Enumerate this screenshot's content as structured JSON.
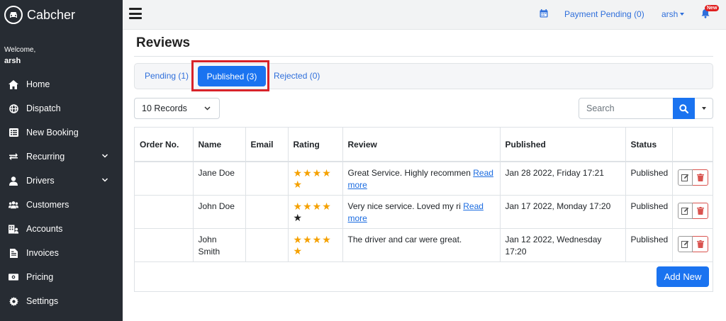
{
  "brand": {
    "name": "Cabcher",
    "icon": "car-icon"
  },
  "sidebar": {
    "welcome": "Welcome,",
    "user": "arsh",
    "items": [
      {
        "label": "Home",
        "icon": "home-icon"
      },
      {
        "label": "Dispatch",
        "icon": "globe-icon"
      },
      {
        "label": "New Booking",
        "icon": "list-icon"
      },
      {
        "label": "Recurring",
        "icon": "repeat-icon",
        "expandable": true
      },
      {
        "label": "Drivers",
        "icon": "user-icon",
        "expandable": true
      },
      {
        "label": "Customers",
        "icon": "users-icon"
      },
      {
        "label": "Accounts",
        "icon": "accounts-icon"
      },
      {
        "label": "Invoices",
        "icon": "invoice-icon"
      },
      {
        "label": "Pricing",
        "icon": "money-icon"
      },
      {
        "label": "Settings",
        "icon": "gear-icon"
      }
    ]
  },
  "topbar": {
    "payment_label": "Payment Pending (0)",
    "user_label": "arsh",
    "notification_badge": "New"
  },
  "page": {
    "title": "Reviews"
  },
  "tabs": [
    {
      "label": "Pending (1)",
      "active": false
    },
    {
      "label": "Published (3)",
      "active": true
    },
    {
      "label": "Rejected (0)",
      "active": false
    }
  ],
  "toolbar": {
    "records_label": "10 Records",
    "search_placeholder": "Search"
  },
  "table": {
    "headers": [
      "Order No.",
      "Name",
      "Email",
      "Rating",
      "Review",
      "Published",
      "Status",
      ""
    ],
    "rows": [
      {
        "order_no": "",
        "name": "Jane Doe",
        "email": "",
        "rating": 5,
        "review": "Great Service. Highly recommen",
        "read_more": "Read more",
        "published": "Jan 28 2022, Friday 17:21",
        "status": "Published"
      },
      {
        "order_no": "",
        "name": "John Doe",
        "email": "",
        "rating": 4,
        "review": "Very nice service. Loved my ri",
        "read_more": "Read more",
        "published": "Jan 17 2022, Monday 17:20",
        "status": "Published"
      },
      {
        "order_no": "",
        "name": "John Smith",
        "email": "",
        "rating": 5,
        "review": "The driver and car were great.",
        "read_more": "",
        "published": "Jan 12 2022, Wednesday 17:20",
        "status": "Published"
      }
    ]
  },
  "add_new_label": "Add New",
  "colors": {
    "sidebar_bg": "#272c33",
    "primary": "#1a73f0",
    "star": "#f5a100",
    "danger": "#d9534f",
    "highlight": "#d8232a"
  }
}
